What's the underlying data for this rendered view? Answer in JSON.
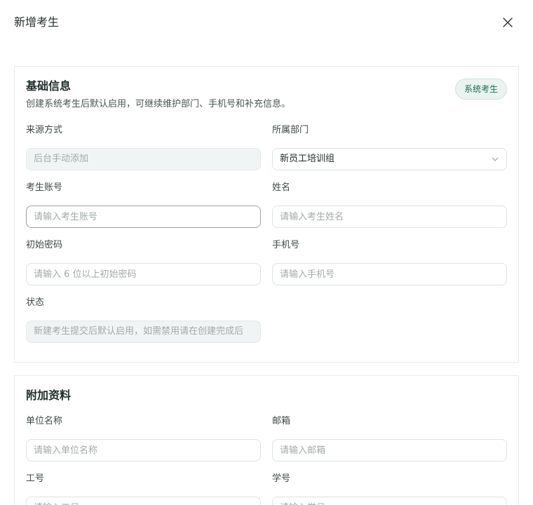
{
  "dialog": {
    "title": "新增考生",
    "close_icon": "close-icon"
  },
  "basic": {
    "title": "基础信息",
    "description": "创建系统考生后默认启用，可继续维护部门、手机号和补充信息。",
    "badge": "系统考生",
    "source": {
      "label": "来源方式",
      "value": "后台手动添加"
    },
    "department": {
      "label": "所属部门",
      "value": "新员工培训组",
      "icon": "chevron-down-icon"
    },
    "account": {
      "label": "考生账号",
      "placeholder": "请输入考生账号"
    },
    "name": {
      "label": "姓名",
      "placeholder": "请输入考生姓名"
    },
    "password": {
      "label": "初始密码",
      "placeholder": "请输入 6 位以上初始密码"
    },
    "phone": {
      "label": "手机号",
      "placeholder": "请输入手机号"
    },
    "status": {
      "label": "状态",
      "value": "新建考生提交后默认启用，如需禁用请在创建完成后"
    }
  },
  "extra": {
    "title": "附加资料",
    "org": {
      "label": "单位名称",
      "placeholder": "请输入单位名称"
    },
    "email": {
      "label": "邮箱",
      "placeholder": "请输入邮箱"
    },
    "work_id": {
      "label": "工号",
      "placeholder": "请输入工号"
    },
    "student_id": {
      "label": "学号",
      "placeholder": "请输入学号"
    }
  },
  "colors": {
    "accent": "#1f6b56",
    "badge_bg": "#eaf3f0",
    "border": "#dde3e1",
    "disabled_bg": "#f1f4f4"
  }
}
